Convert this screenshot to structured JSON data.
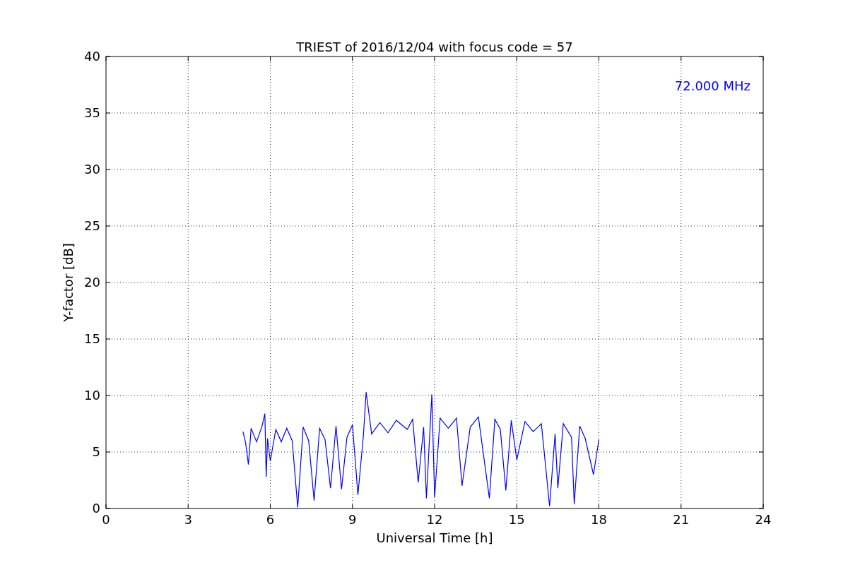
{
  "figure": {
    "chart_data": {
      "type": "line",
      "title": "TRIEST of 2016/12/04 with focus code = 57",
      "xlabel": "Universal Time [h]",
      "ylabel": "Y-factor [dB]",
      "xlim": [
        0,
        24
      ],
      "ylim": [
        0,
        40
      ],
      "xticks": [
        0,
        3,
        6,
        9,
        12,
        15,
        18,
        21,
        24
      ],
      "yticks": [
        0,
        5,
        10,
        15,
        20,
        25,
        30,
        35,
        40
      ],
      "x": [
        5.0,
        5.1,
        5.2,
        5.3,
        5.5,
        5.7,
        5.8,
        5.85,
        5.9,
        6.0,
        6.2,
        6.4,
        6.6,
        6.8,
        7.0,
        7.2,
        7.4,
        7.6,
        7.8,
        8.0,
        8.2,
        8.4,
        8.6,
        8.8,
        9.0,
        9.2,
        9.4,
        9.5,
        9.7,
        10.0,
        10.3,
        10.6,
        11.0,
        11.2,
        11.4,
        11.6,
        11.7,
        11.9,
        12.0,
        12.2,
        12.5,
        12.8,
        13.0,
        13.3,
        13.6,
        14.0,
        14.2,
        14.4,
        14.6,
        14.8,
        15.0,
        15.3,
        15.6,
        15.9,
        16.2,
        16.4,
        16.5,
        16.7,
        17.0,
        17.1,
        17.3,
        17.5,
        17.8,
        18.0
      ],
      "series": [
        {
          "name": "72.000 MHz",
          "color": "#0000ff",
          "values": [
            6.8,
            5.8,
            3.9,
            7.1,
            5.9,
            7.3,
            8.4,
            2.8,
            6.2,
            4.2,
            7.0,
            5.9,
            7.1,
            6.0,
            0.1,
            7.2,
            6.0,
            0.7,
            7.1,
            6.1,
            1.8,
            7.3,
            1.7,
            6.3,
            7.4,
            1.2,
            6.5,
            10.3,
            6.6,
            7.6,
            6.7,
            7.8,
            7.0,
            7.9,
            2.3,
            7.2,
            0.9,
            10.1,
            1.0,
            8.0,
            7.1,
            8.0,
            2.0,
            7.2,
            8.1,
            0.9,
            7.9,
            7.0,
            1.6,
            7.8,
            4.3,
            7.7,
            6.8,
            7.5,
            0.2,
            6.6,
            1.8,
            7.5,
            6.3,
            0.4,
            7.3,
            6.2,
            3.0,
            6.1
          ]
        }
      ],
      "grid": true
    }
  }
}
